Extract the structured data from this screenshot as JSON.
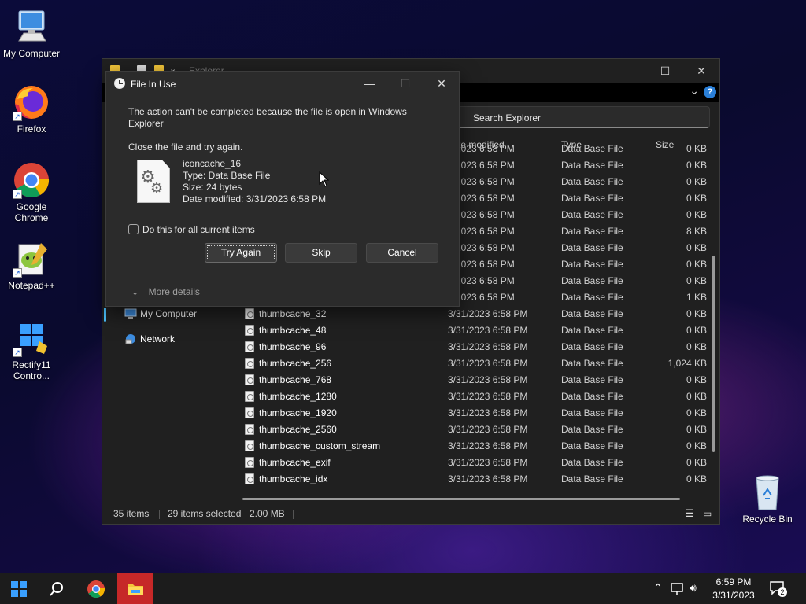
{
  "desktop": {
    "icons": [
      {
        "label": "My Computer"
      },
      {
        "label": "Firefox"
      },
      {
        "label": "Google Chrome"
      },
      {
        "label": "Notepad++"
      },
      {
        "label": "Rectify11 Contro..."
      },
      {
        "label": "Recycle Bin"
      }
    ]
  },
  "explorer": {
    "title": "Explorer",
    "search_placeholder": "Search Explorer",
    "columns": {
      "date": "te modified",
      "type": "Type",
      "size": "Size"
    },
    "nav": [
      {
        "label": "My Computer"
      },
      {
        "label": "Network"
      }
    ],
    "rows": [
      {
        "name": "",
        "date": "1/2023 6:58 PM",
        "type": "Data Base File",
        "size": "0 KB"
      },
      {
        "name": "",
        "date": "1/2023 6:58 PM",
        "type": "Data Base File",
        "size": "0 KB"
      },
      {
        "name": "",
        "date": "1/2023 6:58 PM",
        "type": "Data Base File",
        "size": "0 KB"
      },
      {
        "name": "",
        "date": "1/2023 6:58 PM",
        "type": "Data Base File",
        "size": "0 KB"
      },
      {
        "name": "",
        "date": "1/2023 6:58 PM",
        "type": "Data Base File",
        "size": "0 KB"
      },
      {
        "name": "",
        "date": "1/2023 6:58 PM",
        "type": "Data Base File",
        "size": "8 KB"
      },
      {
        "name": "",
        "date": "1/2023 6:58 PM",
        "type": "Data Base File",
        "size": "0 KB"
      },
      {
        "name": "",
        "date": "1/2023 6:58 PM",
        "type": "Data Base File",
        "size": "0 KB"
      },
      {
        "name": "",
        "date": "1/2023 6:58 PM",
        "type": "Data Base File",
        "size": "0 KB"
      },
      {
        "name": "",
        "date": "1/2023 6:58 PM",
        "type": "Data Base File",
        "size": "1 KB"
      },
      {
        "name": "thumbcache_32",
        "date": "3/31/2023 6:58 PM",
        "type": "Data Base File",
        "size": "0 KB"
      },
      {
        "name": "thumbcache_48",
        "date": "3/31/2023 6:58 PM",
        "type": "Data Base File",
        "size": "0 KB"
      },
      {
        "name": "thumbcache_96",
        "date": "3/31/2023 6:58 PM",
        "type": "Data Base File",
        "size": "0 KB"
      },
      {
        "name": "thumbcache_256",
        "date": "3/31/2023 6:58 PM",
        "type": "Data Base File",
        "size": "1,024 KB"
      },
      {
        "name": "thumbcache_768",
        "date": "3/31/2023 6:58 PM",
        "type": "Data Base File",
        "size": "0 KB"
      },
      {
        "name": "thumbcache_1280",
        "date": "3/31/2023 6:58 PM",
        "type": "Data Base File",
        "size": "0 KB"
      },
      {
        "name": "thumbcache_1920",
        "date": "3/31/2023 6:58 PM",
        "type": "Data Base File",
        "size": "0 KB"
      },
      {
        "name": "thumbcache_2560",
        "date": "3/31/2023 6:58 PM",
        "type": "Data Base File",
        "size": "0 KB"
      },
      {
        "name": "thumbcache_custom_stream",
        "date": "3/31/2023 6:58 PM",
        "type": "Data Base File",
        "size": "0 KB"
      },
      {
        "name": "thumbcache_exif",
        "date": "3/31/2023 6:58 PM",
        "type": "Data Base File",
        "size": "0 KB"
      },
      {
        "name": "thumbcache_idx",
        "date": "3/31/2023 6:58 PM",
        "type": "Data Base File",
        "size": "0 KB"
      }
    ],
    "status": {
      "items": "35 items",
      "selected": "29 items selected",
      "size": "2.00 MB"
    }
  },
  "dialog": {
    "title": "File In Use",
    "message": "The action can't be completed because the file is open in Windows Explorer",
    "sub": "Close the file and try again.",
    "file": {
      "name": "iconcache_16",
      "type": "Type: Data Base File",
      "size": "Size: 24 bytes",
      "modified": "Date modified: 3/31/2023 6:58 PM"
    },
    "checkbox_label": "Do this for all current items",
    "checkbox_checked": false,
    "buttons": {
      "try_again": "Try Again",
      "skip": "Skip",
      "cancel": "Cancel"
    },
    "more_details": "More details"
  },
  "taskbar": {
    "time": "6:59 PM",
    "date": "3/31/2023",
    "notification_count": "2"
  }
}
